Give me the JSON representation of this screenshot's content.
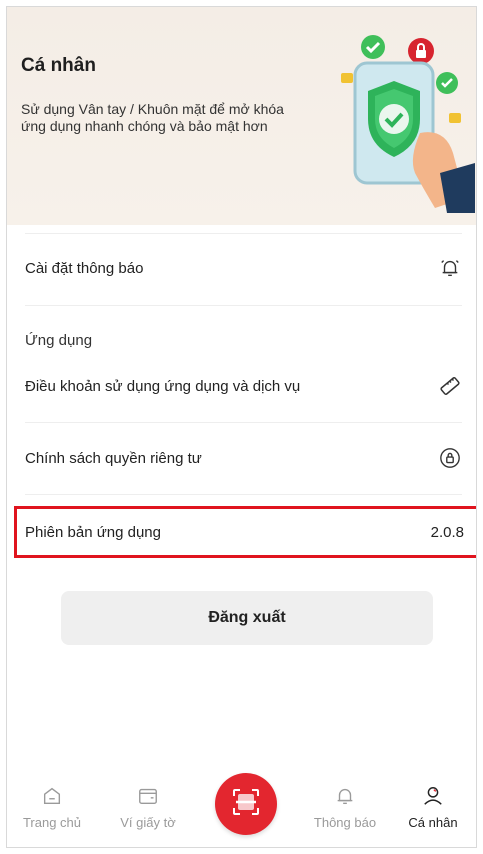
{
  "colors": {
    "accent": "#e3262f",
    "highlight": "#e0141e",
    "hero_bg": "#f4ede6"
  },
  "hero": {
    "title": "Cá nhân",
    "description": "Sử dụng Vân tay / Khuôn mặt để mở khóa ứng dụng nhanh chóng và bảo mật hơn"
  },
  "settings": {
    "notifications": {
      "label": "Cài đặt thông báo",
      "icon": "bell-icon"
    },
    "app_section_label": "Ứng dụng",
    "terms": {
      "label": "Điều khoản sử dụng ứng dụng và dịch vụ",
      "icon": "ruler-icon"
    },
    "privacy": {
      "label": "Chính sách quyền riêng tư",
      "icon": "lock-badge-icon"
    },
    "version": {
      "label": "Phiên bản ứng dụng",
      "value": "2.0.8"
    }
  },
  "logout_label": "Đăng xuất",
  "tabs": [
    {
      "label": "Trang chủ",
      "icon": "home-icon",
      "active": false
    },
    {
      "label": "Ví giấy tờ",
      "icon": "wallet-icon",
      "active": false
    },
    {
      "label": "",
      "icon": "scan-icon",
      "active": false
    },
    {
      "label": "Thông báo",
      "icon": "bell-icon",
      "active": false
    },
    {
      "label": "Cá nhân",
      "icon": "user-icon",
      "active": true
    }
  ]
}
